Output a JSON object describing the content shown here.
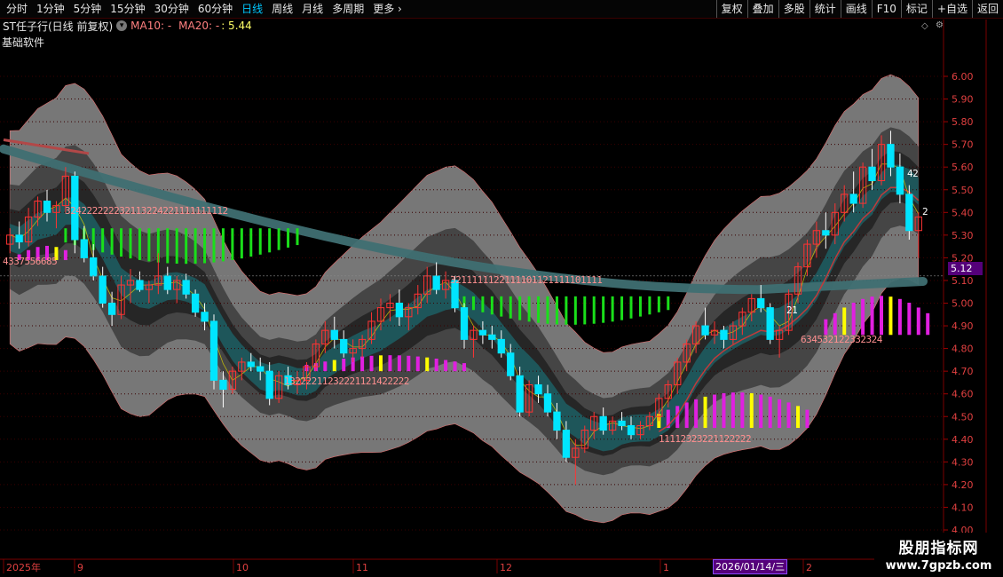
{
  "toolbar": {
    "periods": [
      "分时",
      "1分钟",
      "5分钟",
      "15分钟",
      "30分钟",
      "60分钟",
      "日线",
      "周线",
      "月线",
      "多周期",
      "更多"
    ],
    "active_period": "日线",
    "more_arrow_icon": "chevron-right-icon",
    "tools": [
      "复权",
      "叠加",
      "多股",
      "统计",
      "画线",
      "F10",
      "标记",
      "+自选",
      "返回"
    ]
  },
  "info": {
    "title": "ST任子行(日线 前复权)",
    "dropdown_icon": "chevron-down-icon",
    "ma10": "MA10: -",
    "ma20": "MA20: -",
    "ma_extra": ": 5.44",
    "subtitle": "基础软件"
  },
  "colors": {
    "up": "#ff3333",
    "down": "#00e5ff",
    "ma_band": "#2f6f6f",
    "red_line": "#c23a3a",
    "green_hist": "#1adf1a",
    "magenta_hist": "#e020e0",
    "yellow_hist": "#ffff00",
    "accent_tab": "#00c8ff",
    "tag_bg": "#55007a"
  },
  "chart_data": {
    "type": "candlestick",
    "y_axis_ticks": [
      "6.00",
      "5.90",
      "5.80",
      "5.70",
      "5.60",
      "5.50",
      "5.40",
      "5.30",
      "5.20",
      "5.10",
      "5.00",
      "4.90",
      "4.80",
      "4.70",
      "4.60",
      "4.50",
      "4.40",
      "4.30",
      "4.20",
      "4.10",
      "4.00"
    ],
    "ylim": [
      4.0,
      6.0
    ],
    "current_price": "5.12",
    "x_axis_labels": [
      "2025年",
      "9",
      "10",
      "11",
      "12",
      "1",
      "2026/01/14/三",
      "2"
    ],
    "count_labels": {
      "top_left": "324222222232113224221111111112",
      "top_mid": "3211111122111101121111101111",
      "bottom_left": "4337556685",
      "bottom_mid1": "13222211232221121422222",
      "bottom_mid2": "11112323221122222",
      "bottom_right": "634532122332324",
      "right_small_1": "21",
      "right_small_2": "42",
      "right_small_3": "2"
    },
    "candles": [
      [
        5.26,
        5.33,
        5.22,
        5.3
      ],
      [
        5.3,
        5.36,
        5.24,
        5.27
      ],
      [
        5.27,
        5.42,
        5.25,
        5.38
      ],
      [
        5.38,
        5.47,
        5.34,
        5.45
      ],
      [
        5.45,
        5.5,
        5.36,
        5.4
      ],
      [
        5.4,
        5.45,
        5.33,
        5.43
      ],
      [
        5.43,
        5.6,
        5.4,
        5.56
      ],
      [
        5.56,
        5.58,
        5.22,
        5.28
      ],
      [
        5.28,
        5.34,
        5.18,
        5.2
      ],
      [
        5.2,
        5.26,
        5.1,
        5.12
      ],
      [
        5.12,
        5.16,
        4.98,
        5.0
      ],
      [
        5.0,
        5.05,
        4.9,
        4.95
      ],
      [
        4.95,
        5.12,
        4.93,
        5.08
      ],
      [
        5.08,
        5.15,
        5.0,
        5.1
      ],
      [
        5.1,
        5.14,
        5.05,
        5.06
      ],
      [
        5.06,
        5.1,
        5.0,
        5.08
      ],
      [
        5.08,
        5.22,
        5.04,
        5.12
      ],
      [
        5.12,
        5.16,
        5.04,
        5.06
      ],
      [
        5.06,
        5.12,
        5.0,
        5.1
      ],
      [
        5.1,
        5.13,
        5.02,
        5.04
      ],
      [
        5.04,
        5.06,
        4.94,
        4.96
      ],
      [
        4.96,
        5.0,
        4.88,
        4.92
      ],
      [
        4.92,
        4.95,
        4.62,
        4.66
      ],
      [
        4.66,
        4.7,
        4.54,
        4.62
      ],
      [
        4.62,
        4.72,
        4.6,
        4.7
      ],
      [
        4.7,
        4.76,
        4.66,
        4.74
      ],
      [
        4.74,
        4.78,
        4.7,
        4.72
      ],
      [
        4.72,
        4.76,
        4.66,
        4.7
      ],
      [
        4.7,
        4.74,
        4.55,
        4.58
      ],
      [
        4.58,
        4.7,
        4.56,
        4.68
      ],
      [
        4.68,
        4.72,
        4.62,
        4.64
      ],
      [
        4.64,
        4.7,
        4.6,
        4.66
      ],
      [
        4.66,
        4.74,
        4.62,
        4.72
      ],
      [
        4.72,
        4.84,
        4.7,
        4.82
      ],
      [
        4.82,
        4.92,
        4.78,
        4.88
      ],
      [
        4.88,
        4.94,
        4.8,
        4.84
      ],
      [
        4.84,
        4.88,
        4.76,
        4.78
      ],
      [
        4.78,
        4.84,
        4.74,
        4.8
      ],
      [
        4.8,
        4.86,
        4.76,
        4.84
      ],
      [
        4.84,
        4.96,
        4.82,
        4.92
      ],
      [
        4.92,
        5.02,
        4.88,
        4.98
      ],
      [
        4.98,
        5.04,
        4.92,
        5.0
      ],
      [
        5.0,
        5.06,
        4.9,
        4.94
      ],
      [
        4.94,
        5.0,
        4.88,
        4.98
      ],
      [
        4.98,
        5.08,
        4.95,
        5.04
      ],
      [
        5.04,
        5.16,
        5.0,
        5.12
      ],
      [
        5.12,
        5.18,
        5.04,
        5.06
      ],
      [
        5.06,
        5.14,
        5.02,
        5.1
      ],
      [
        5.1,
        5.12,
        4.96,
        4.98
      ],
      [
        4.98,
        5.0,
        4.8,
        4.84
      ],
      [
        4.84,
        4.9,
        4.76,
        4.88
      ],
      [
        4.88,
        4.92,
        4.82,
        4.86
      ],
      [
        4.86,
        4.9,
        4.8,
        4.84
      ],
      [
        4.84,
        4.88,
        4.76,
        4.78
      ],
      [
        4.78,
        4.82,
        4.66,
        4.68
      ],
      [
        4.68,
        4.72,
        4.5,
        4.52
      ],
      [
        4.52,
        4.66,
        4.5,
        4.64
      ],
      [
        4.64,
        4.68,
        4.56,
        4.6
      ],
      [
        4.6,
        4.64,
        4.5,
        4.52
      ],
      [
        4.52,
        4.56,
        4.4,
        4.44
      ],
      [
        4.44,
        4.48,
        4.3,
        4.32
      ],
      [
        4.32,
        4.4,
        4.2,
        4.36
      ],
      [
        4.36,
        4.46,
        4.34,
        4.44
      ],
      [
        4.44,
        4.52,
        4.4,
        4.5
      ],
      [
        4.5,
        4.54,
        4.42,
        4.44
      ],
      [
        4.44,
        4.5,
        4.42,
        4.48
      ],
      [
        4.48,
        4.52,
        4.44,
        4.46
      ],
      [
        4.46,
        4.5,
        4.4,
        4.42
      ],
      [
        4.42,
        4.48,
        4.4,
        4.46
      ],
      [
        4.46,
        4.52,
        4.44,
        4.5
      ],
      [
        4.5,
        4.6,
        4.48,
        4.58
      ],
      [
        4.58,
        4.66,
        4.54,
        4.64
      ],
      [
        4.64,
        4.76,
        4.6,
        4.74
      ],
      [
        4.74,
        4.84,
        4.7,
        4.82
      ],
      [
        4.82,
        4.92,
        4.78,
        4.9
      ],
      [
        4.9,
        4.98,
        4.84,
        4.86
      ],
      [
        4.86,
        4.92,
        4.82,
        4.88
      ],
      [
        4.88,
        4.9,
        4.8,
        4.84
      ],
      [
        4.84,
        4.92,
        4.82,
        4.9
      ],
      [
        4.9,
        4.98,
        4.86,
        4.96
      ],
      [
        4.96,
        5.04,
        4.92,
        5.02
      ],
      [
        5.02,
        5.08,
        4.96,
        4.98
      ],
      [
        4.98,
        5.0,
        4.82,
        4.84
      ],
      [
        4.84,
        4.9,
        4.76,
        4.88
      ],
      [
        4.88,
        5.06,
        4.86,
        5.04
      ],
      [
        5.04,
        5.18,
        5.0,
        5.16
      ],
      [
        5.16,
        5.28,
        5.12,
        5.26
      ],
      [
        5.26,
        5.36,
        5.2,
        5.32
      ],
      [
        5.32,
        5.4,
        5.24,
        5.3
      ],
      [
        5.3,
        5.44,
        5.26,
        5.4
      ],
      [
        5.4,
        5.52,
        5.36,
        5.48
      ],
      [
        5.48,
        5.58,
        5.4,
        5.44
      ],
      [
        5.44,
        5.62,
        5.42,
        5.6
      ],
      [
        5.6,
        5.68,
        5.5,
        5.54
      ],
      [
        5.54,
        5.74,
        5.52,
        5.7
      ],
      [
        5.7,
        5.76,
        5.56,
        5.6
      ],
      [
        5.6,
        5.66,
        5.44,
        5.48
      ],
      [
        5.48,
        5.52,
        5.28,
        5.32
      ],
      [
        5.32,
        5.4,
        5.2,
        5.38
      ]
    ]
  }
}
